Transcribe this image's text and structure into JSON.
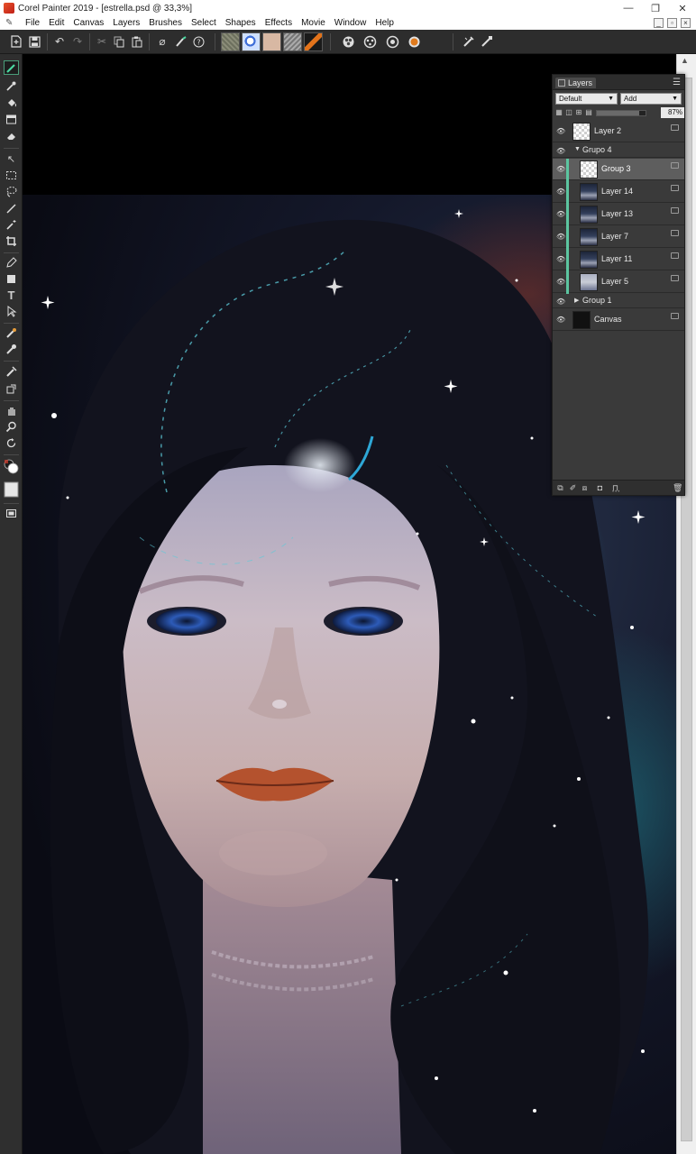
{
  "window": {
    "title": "Corel Painter 2019 - [estrella.psd @ 33,3%]",
    "minimize": "—",
    "maximize": "❐",
    "close": "✕"
  },
  "menu": {
    "items": [
      "File",
      "Edit",
      "Canvas",
      "Layers",
      "Brushes",
      "Select",
      "Shapes",
      "Effects",
      "Movie",
      "Window",
      "Help"
    ]
  },
  "toolbar": {
    "icons": [
      "new-document-icon",
      "save-icon",
      "undo-icon",
      "redo-icon",
      "cut-icon",
      "copy-icon",
      "paste-icon",
      "brush-library-icon",
      "brush-variant-icon",
      "help-icon",
      "paper-icon",
      "flow-map-icon",
      "texture-icon",
      "gradient-icon",
      "pattern-icon",
      "color-wheel-icon",
      "mixer-icon",
      "color-sets-icon",
      "color-swatch-icon",
      "brush-ghost-icon",
      "dab-preview-icon"
    ]
  },
  "tools": {
    "icons": [
      "brush-tool-icon",
      "dropper-tool-icon",
      "paint-bucket-icon",
      "rectangle-fill-icon",
      "eraser-tool-icon",
      "transform-tool-icon",
      "rectangular-select-icon",
      "lasso-tool-icon",
      "line-tool-icon",
      "magic-wand-icon",
      "crop-tool-icon",
      "pen-tool-icon",
      "shape-tool-icon",
      "text-tool-icon",
      "shape-selection-icon",
      "cloner-tool-icon",
      "rubber-stamp-icon",
      "dodge-tool-icon",
      "burn-tool-icon",
      "grabber-tool-icon",
      "magnifier-icon",
      "rotate-page-icon",
      "main-color-icon",
      "paper-color-icon",
      "screen-mode-icon"
    ],
    "main_color": "#1a1a1a",
    "secondary_color": "#ffffff",
    "paper_color": "#e6e6e6"
  },
  "layers_panel": {
    "tab_label": "Layers",
    "menu_glyph": "☰",
    "composite_method": "Default",
    "composite_depth": "Add",
    "opacity": "87%",
    "opacity_fraction": 0.87,
    "layers": [
      {
        "name": "Layer 2",
        "type": "layer",
        "thumb": "checker",
        "selected": false,
        "indent": 0
      },
      {
        "name": "Grupo 4",
        "type": "group",
        "expanded": true,
        "selected": false,
        "indent": 0
      },
      {
        "name": "Group 3",
        "type": "layer",
        "thumb": "checker",
        "selected": true,
        "indent": 1
      },
      {
        "name": "Layer 14",
        "type": "layer",
        "thumb": "portrait",
        "selected": false,
        "indent": 1
      },
      {
        "name": "Layer 13",
        "type": "layer",
        "thumb": "portrait",
        "selected": false,
        "indent": 1
      },
      {
        "name": "Layer 7",
        "type": "layer",
        "thumb": "portrait",
        "selected": false,
        "indent": 1
      },
      {
        "name": "Layer 11",
        "type": "layer",
        "thumb": "portrait",
        "selected": false,
        "indent": 1
      },
      {
        "name": "Layer 5",
        "type": "layer",
        "thumb": "portrait-light",
        "selected": false,
        "indent": 1
      },
      {
        "name": "Group 1",
        "type": "group",
        "expanded": false,
        "selected": false,
        "indent": 0
      },
      {
        "name": "Canvas",
        "type": "canvas",
        "thumb": "dark",
        "selected": false,
        "indent": 0
      }
    ],
    "footer_icons": [
      "new-layer-icon",
      "dynamic-plugins-icon",
      "new-group-icon",
      "layer-mask-icon",
      "lock-layer-icon",
      "delete-layer-icon"
    ]
  },
  "colors": {
    "ui_dark": "#2d2d2d",
    "panel": "#3a3a3a",
    "selection": "#5e5e5e",
    "accent": "#4ad8a1"
  }
}
